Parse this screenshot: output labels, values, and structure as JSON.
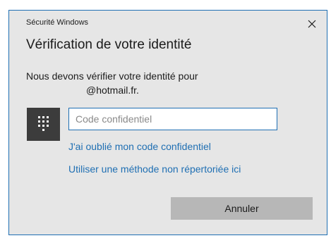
{
  "window": {
    "app_title": "Sécurité Windows"
  },
  "dialog": {
    "heading": "Vérification de votre identité",
    "message": "Nous devons vérifier votre identité pour",
    "account": "@hotmail.fr.",
    "pin_placeholder": "Code confidentiel",
    "pin_value": "",
    "forgot_pin_link": "J'ai oublié mon code confidentiel",
    "other_method_link": "Utiliser une méthode non répertoriée ici",
    "cancel_label": "Annuler"
  },
  "icons": {
    "close": "close-icon",
    "pin_keypad": "keypad-icon"
  },
  "colors": {
    "accent": "#1f6fb3",
    "dialog_bg": "#e6e6e6",
    "tile_bg": "#3c3c3c",
    "button_bg": "#b7b7b7"
  }
}
